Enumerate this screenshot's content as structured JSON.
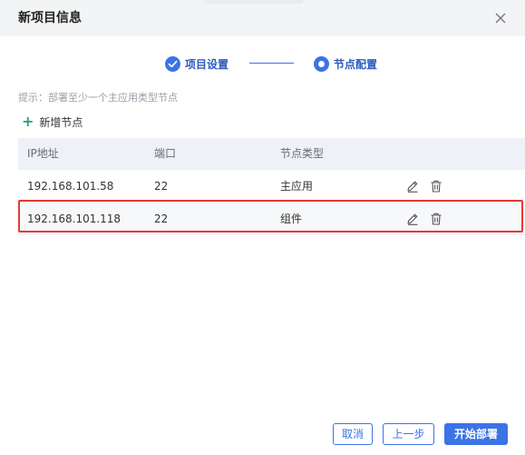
{
  "dialog": {
    "title": "新项目信息",
    "close_icon": "close-icon"
  },
  "steps": [
    {
      "label": "项目设置",
      "status": "completed",
      "icon": "check-circle-icon"
    },
    {
      "label": "节点配置",
      "status": "active",
      "icon": "radio-dot-icon"
    }
  ],
  "hint": "提示：部署至少一个主应用类型节点",
  "add_node": {
    "icon": "plus-icon",
    "label": "新增节点"
  },
  "table": {
    "columns": [
      "IP地址",
      "端口",
      "节点类型"
    ],
    "rows": [
      {
        "ip": "192.168.101.58",
        "port": "22",
        "type": "主应用",
        "highlighted": false
      },
      {
        "ip": "192.168.101.118",
        "port": "22",
        "type": "组件",
        "highlighted": true
      }
    ],
    "row_actions": [
      "edit-icon",
      "delete-icon"
    ]
  },
  "footer": {
    "cancel": "取消",
    "prev": "上一步",
    "deploy": "开始部署"
  },
  "colors": {
    "accent": "#3b73e6",
    "add_icon": "#27a86a",
    "highlight_border": "#e53935",
    "header_bg": "#f3f4f6",
    "table_header_bg": "#eef1f5"
  }
}
